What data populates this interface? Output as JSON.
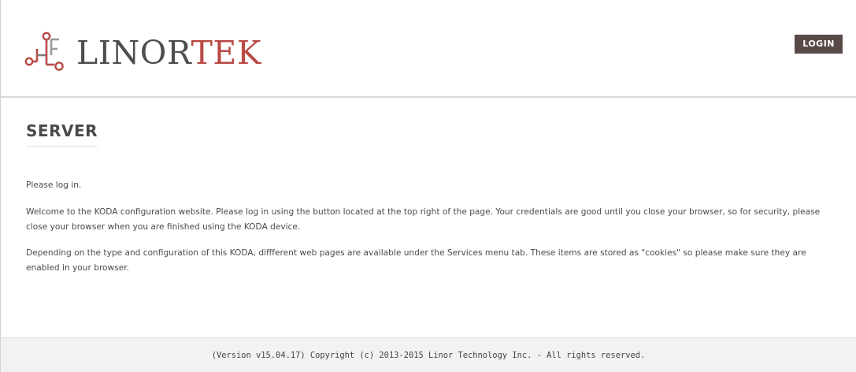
{
  "header": {
    "logo": {
      "text_part1": "LINOR",
      "text_part2": "TEK",
      "icon": "circuit-logo-icon",
      "colors": {
        "dark": "#4d4d4d",
        "accent": "#b84a45"
      }
    },
    "login_label": "LOGIN",
    "login_color": "#5a4a47"
  },
  "main": {
    "title": "SERVER",
    "paragraphs": [
      "Please log in.",
      "Welcome to the KODA configuration website. Please log in using the button located at the top right of the page. Your credentials are good until you close your browser, so for security, please close your browser when you are finished using the KODA device.",
      "Depending on the type and configuration of this KODA, diffferent web pages are available under the Services menu tab. These items are stored as \"cookies\" so please make sure they are enabled in your browser."
    ]
  },
  "footer": {
    "text": "(Version v15.04.17) Copyright (c) 2013-2015 Linor Technology Inc. - All rights reserved."
  }
}
